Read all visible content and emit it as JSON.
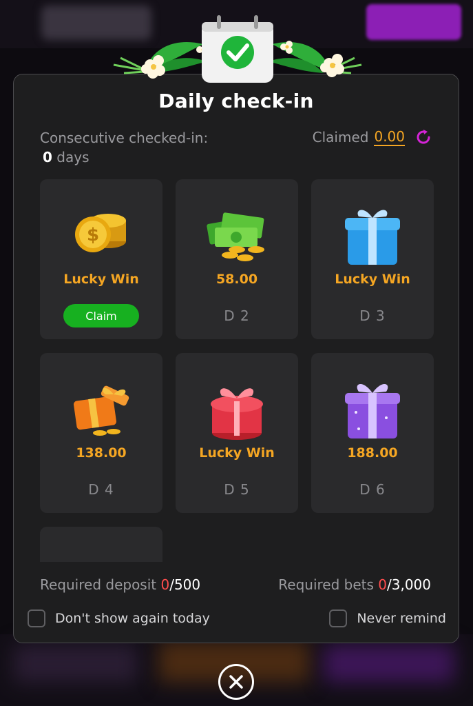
{
  "modal": {
    "title": "Daily check-in",
    "consecutive_label": "Consecutive checked-in:",
    "consecutive_days_value": "0",
    "consecutive_days_unit": "days",
    "claimed_label": "Claimed",
    "claimed_amount": "0.00",
    "cards": [
      {
        "reward": "Lucky Win",
        "day": "",
        "claim_label": "Claim",
        "icon": "coins-icon"
      },
      {
        "reward": "58.00",
        "day": "D 2",
        "icon": "cash-stack-icon"
      },
      {
        "reward": "Lucky Win",
        "day": "D 3",
        "icon": "blue-gift-icon"
      },
      {
        "reward": "138.00",
        "day": "D 4",
        "icon": "orange-gift-icon"
      },
      {
        "reward": "Lucky Win",
        "day": "D 5",
        "icon": "red-gift-icon"
      },
      {
        "reward": "188.00",
        "day": "D 6",
        "icon": "purple-gift-icon"
      },
      {
        "reward": "",
        "day": "",
        "icon": "treasure-icon"
      }
    ],
    "required_deposit_label": "Required deposit",
    "required_deposit_current": "0",
    "required_deposit_total": "/500",
    "required_bets_label": "Required bets",
    "required_bets_current": "0",
    "required_bets_total": "/3,000",
    "dont_show_label": "Don't show again today",
    "never_remind_label": "Never remind"
  },
  "colors": {
    "accent": "#f5a623",
    "claim_green": "#17b020",
    "refresh_magenta": "#d424d6",
    "required_red": "#ff4d4d"
  }
}
